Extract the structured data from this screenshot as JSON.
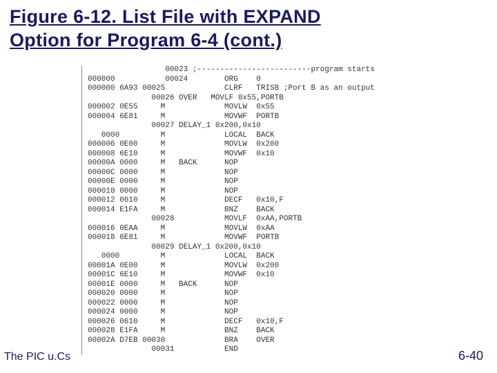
{
  "title_line1": "Figure 6-12. List File with EXPAND",
  "title_line2": "Option for Program 6-4 (cont.)",
  "footer_left": "The PIC u.Cs",
  "footer_right": "6-40",
  "listing": "                 00023 ;-------------------------program starts\n000000           00024        ORG    0\n000000 6A93 00025             CLRF   TRISB ;Port B as an output\n              00026 OVER   MOVLF 0x55,PORTB\n000002 0E55     M             MOVLW  0x55\n000004 6E81     M             MOVWF  PORTB\n              00027 DELAY_1 0x200,0x10\n   0000         M             LOCAL  BACK\n000006 0E00     M             MOVLW  0x200\n000008 6E10     M             MOVWF  0x10\n00000A 0000     M   BACK      NOP\n00000C 0000     M             NOP\n00000E 0000     M             NOP\n000010 0000     M             NOP\n000012 0610     M             DECF   0x10,F\n000014 E1FA     M             BNZ    BACK\n              00028           MOVLF  0xAA,PORTB\n000016 0EAA     M             MOVLW  0xAA\n000018 6E81     M             MOVWF  PORTB\n              00029 DELAY_1 0x200,0x10\n   0000         M             LOCAL  BACK\n00001A 0E00     M             MOVLW  0x200\n00001C 6E10     M             MOVWF  0x10\n00001E 0000     M   BACK      NOP\n000020 0000     M             NOP\n000022 0000     M             NOP\n000024 0000     M             NOP\n000026 0610     M             DECF   0x10,F\n000028 E1FA     M             BNZ    BACK\n00002A D7EB 00030             BRA    OVER\n              00031           END"
}
